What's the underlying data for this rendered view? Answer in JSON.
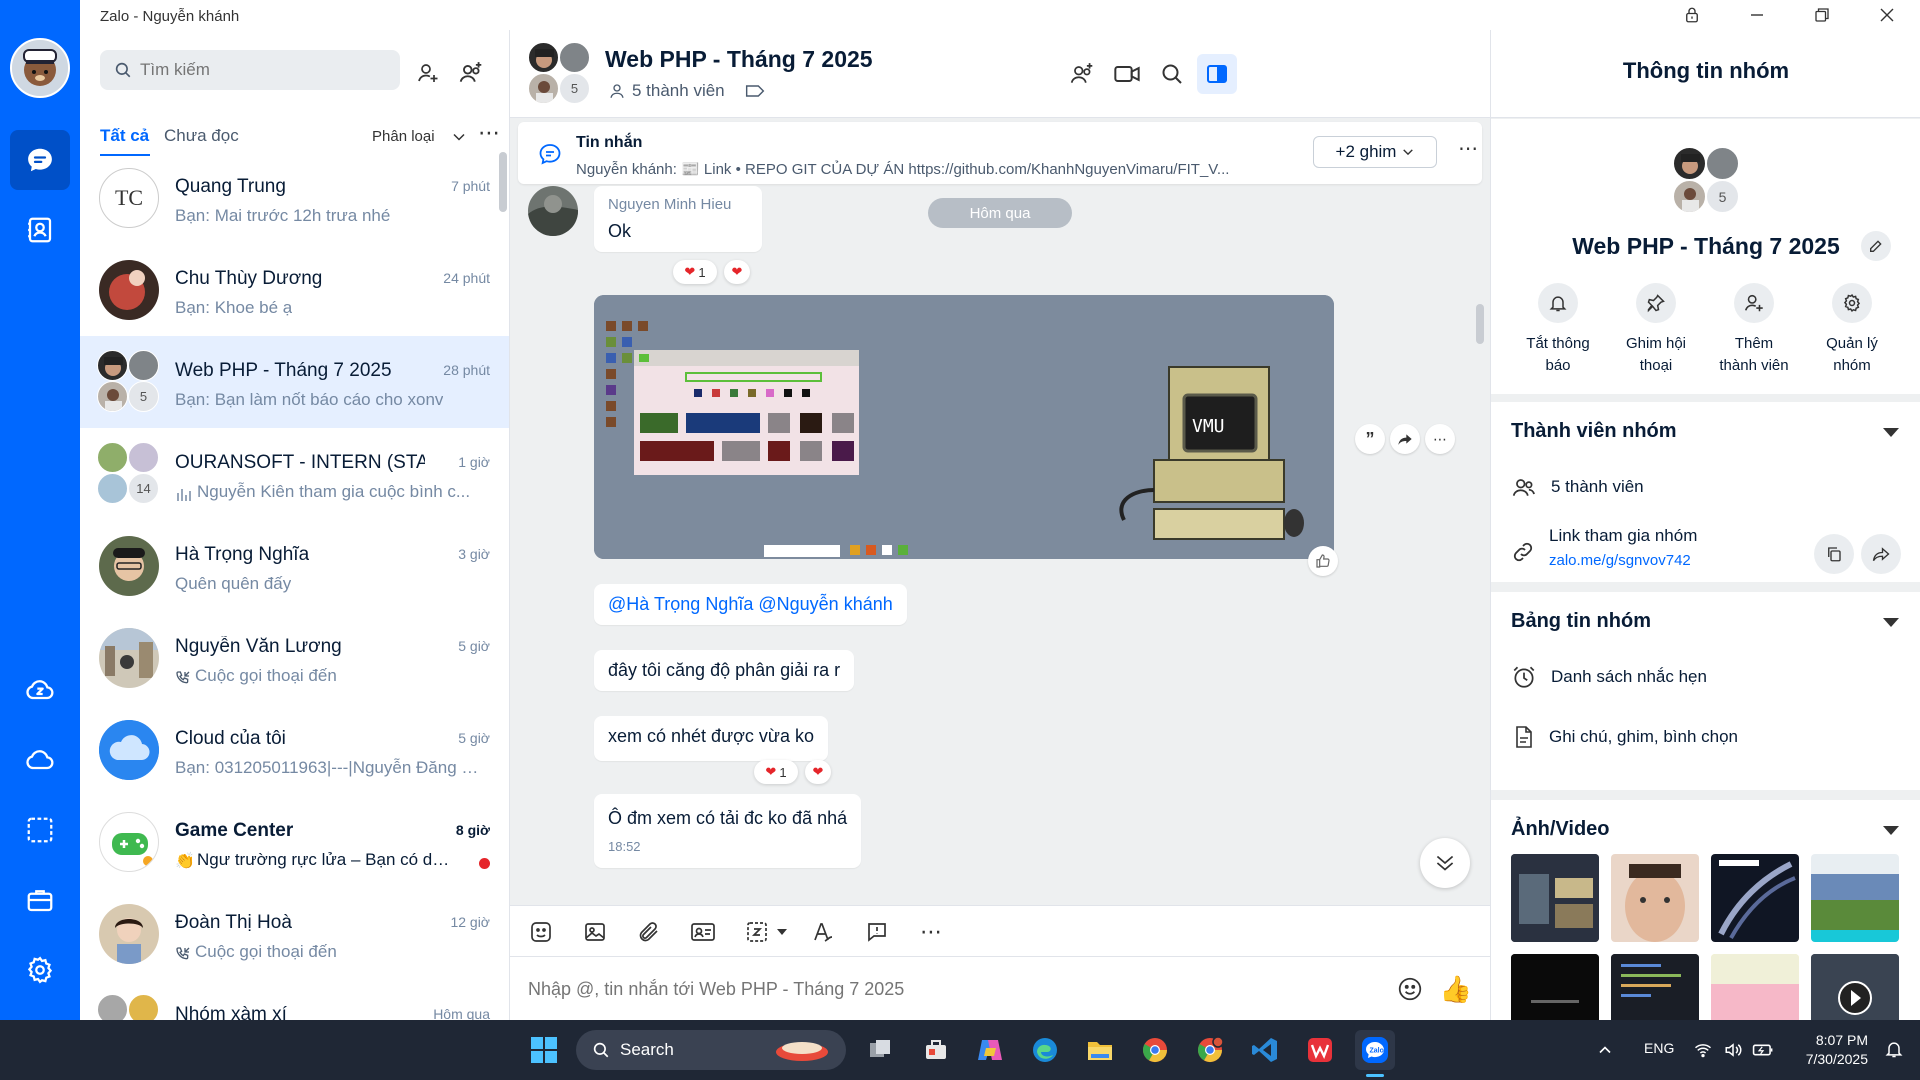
{
  "window": {
    "title": "Zalo - Nguyễn khánh"
  },
  "search": {
    "placeholder": "Tìm kiếm"
  },
  "tabs": {
    "all": "Tất cả",
    "unread": "Chưa đọc",
    "classify": "Phân loại"
  },
  "conversations": [
    {
      "name": "Quang Trung",
      "time": "7 phút",
      "preview": "Bạn: Mai trước 12h trưa nhé",
      "avatar_text": "TC"
    },
    {
      "name": "Chu Thùy Dương",
      "time": "24 phút",
      "preview": "Bạn: Khoe bé ạ"
    },
    {
      "name": "Web PHP - Tháng 7 2025",
      "time": "28 phút",
      "preview": "Bạn: Bạn làm nốt báo cáo cho xonv",
      "count": "5"
    },
    {
      "name": "OURANSOFT - INTERN  (STA...",
      "time": "1 giờ",
      "preview": "Nguyễn Kiên tham gia cuộc bình c...",
      "count": "14"
    },
    {
      "name": "Hà Trọng Nghĩa",
      "time": "3 giờ",
      "preview": "Quên quên đấy"
    },
    {
      "name": "Nguyễn Văn Lương",
      "time": "5 giờ",
      "preview": "Cuộc gọi thoại đến"
    },
    {
      "name": "Cloud của tôi",
      "time": "5 giờ",
      "preview": "Bạn: 031205011963|---|Nguyễn Đăng K..."
    },
    {
      "name": "Game Center",
      "time": "8 giờ",
      "preview": "Ngư trường rực lửa – Bạn có dá..."
    },
    {
      "name": "Đoàn Thị Hoà",
      "time": "12 giờ",
      "preview": "Cuộc gọi thoại đến"
    },
    {
      "name": "Nhóm xàm xí",
      "time": "Hôm qua",
      "preview": ""
    }
  ],
  "chat": {
    "title": "Web PHP - Tháng 7 2025",
    "members": "5 thành viên",
    "member_count": "5",
    "pinned": {
      "label": "Tin nhắn",
      "text": "Nguyễn khánh: 📰 Link • REPO GIT CỦA DỰ ÁN https://github.com/KhanhNguyenVimaru/FIT_V...",
      "more": "+2 ghim"
    },
    "date_divider": "Hôm qua",
    "messages": [
      {
        "sender": "Nguyen Minh Hieu",
        "text": "Ok",
        "reaction_count": "1"
      },
      {
        "mention1": "@Hà Trọng Nghĩa",
        "mention2": "@Nguyễn khánh"
      },
      {
        "text": "đây tôi căng độ phân giải ra r"
      },
      {
        "text": "xem có nhét được vừa ko",
        "reaction_count": "1"
      },
      {
        "text": "Ô đm xem có tải đc ko đã nhá",
        "time": "18:52"
      }
    ],
    "image_screen_text": "VMU"
  },
  "composer": {
    "placeholder": "Nhập @, tin nhắn tới Web PHP - Tháng 7 2025"
  },
  "info": {
    "header": "Thông tin nhóm",
    "group_name": "Web PHP - Tháng 7 2025",
    "member_count": "5",
    "actions": [
      {
        "line1": "Tắt thông",
        "line2": "báo"
      },
      {
        "line1": "Ghim hội",
        "line2": "thoại"
      },
      {
        "line1": "Thêm",
        "line2": "thành viên"
      },
      {
        "line1": "Quản lý",
        "line2": "nhóm"
      }
    ],
    "members_section": {
      "title": "Thành viên nhóm",
      "count": "5 thành viên",
      "link_label": "Link tham gia nhóm",
      "link": "zalo.me/g/sgnvov742"
    },
    "board_section": {
      "title": "Bảng tin nhóm",
      "reminders": "Danh sách nhắc hẹn",
      "notes": "Ghi chú, ghim, bình chọn"
    },
    "media_section": {
      "title": "Ảnh/Video"
    }
  },
  "taskbar": {
    "search": "Search",
    "lang": "ENG",
    "time": "8:07 PM",
    "date": "7/30/2025"
  }
}
